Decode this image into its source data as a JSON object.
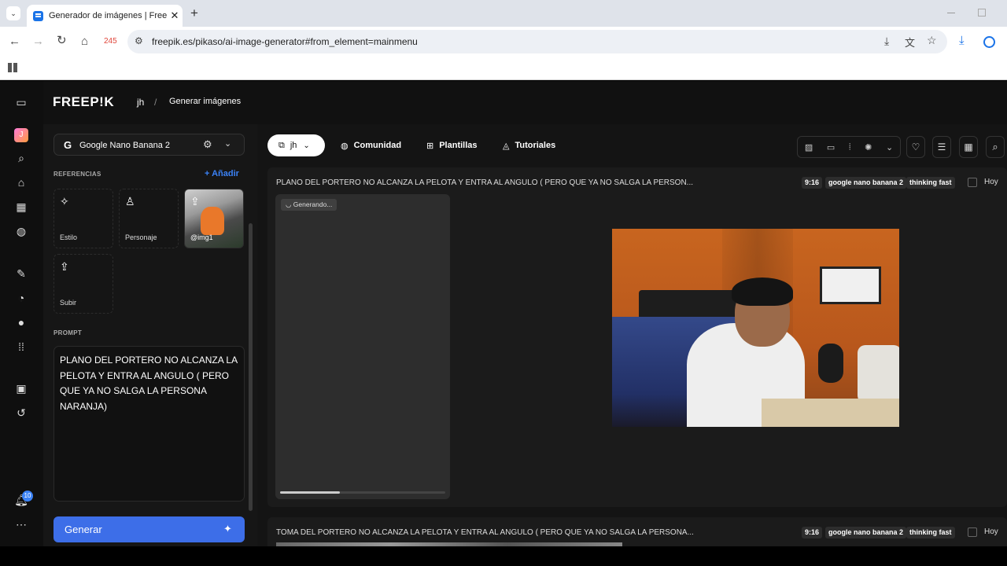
{
  "browser": {
    "tab_title": "Generador de imágenes | Freepik",
    "tab_close": "✕",
    "new_tab": "+",
    "url": "freepik.es/pikaso/ai-image-generator#from_element=mainmenu",
    "home_badge": "245"
  },
  "header": {
    "logo": "FREEP!K",
    "workspace": "jh",
    "separator": "/",
    "page": "Generar imágenes"
  },
  "panel": {
    "model": "Google Nano Banana 2",
    "references_title": "REFERENCIAS",
    "add_label": "Añadir",
    "refs": [
      {
        "label": "Estilo",
        "icon": "style-star-icon"
      },
      {
        "label": "Personaje",
        "icon": "person-icon"
      },
      {
        "label": "@img1",
        "icon": "upload-icon"
      },
      {
        "label": "Subir",
        "icon": "upload-icon"
      }
    ],
    "prompt_title": "PROMPT",
    "prompt_text": "PLANO DEL PORTERO NO ALCANZA LA PELOTA Y ENTRA AL ANGULO ( PERO QUE YA NO SALGA LA PERSONA NARANJA)",
    "generate_label": "Generar",
    "notifications_count": "10"
  },
  "main_toolbar": {
    "workspace_pill": "jh",
    "comunidad": "Comunidad",
    "plantillas": "Plantillas",
    "tutoriales": "Tutoriales"
  },
  "generations": [
    {
      "title": "PLANO DEL PORTERO NO ALCANZA LA PELOTA Y ENTRA AL ANGULO ( PERO QUE YA NO SALGA LA PERSON...",
      "ratio": "9:16",
      "model": "google nano banana 2",
      "mode": "thinking fast",
      "date": "Hoy",
      "status": "Generando..."
    },
    {
      "title": "TOMA DEL PORTERO NO ALCANZA LA PELOTA Y ENTRA AL ANGULO ( PERO QUE YA NO SALGA LA PERSONA...",
      "ratio": "9:16",
      "model": "google nano banana 2",
      "mode": "thinking fast",
      "date": "Hoy"
    }
  ],
  "colors": {
    "accent_blue": "#3b82f6",
    "generate_button": "#3d6ee8",
    "app_bg": "#151515"
  }
}
